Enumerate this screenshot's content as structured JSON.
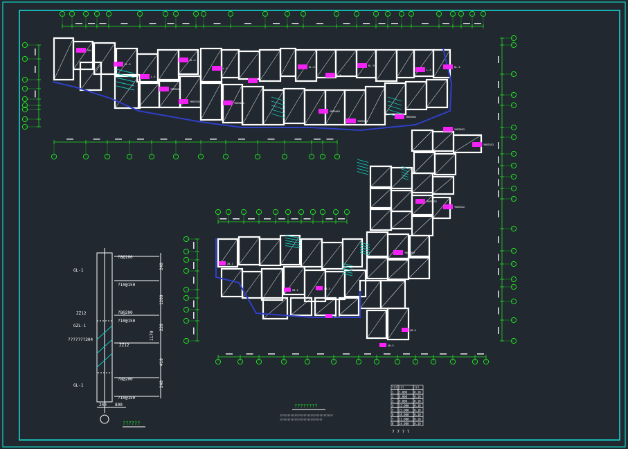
{
  "colors": {
    "background": "#212830",
    "frame": "#17d6d0",
    "wall": "#ffffff",
    "grid": "#22e022",
    "tag": "#ff22ff",
    "accent": "#2f3fc8",
    "hatch": "#13c9b9"
  },
  "detail": {
    "labels": [
      "GL-1",
      "ZZ12",
      "GZL-1",
      "GL-1"
    ],
    "note": "???????304",
    "callouts": [
      "?8@100",
      "?10@150",
      "?8@200",
      "?10@150",
      "?8@200",
      "?10@150"
    ],
    "right_dims": [
      "240",
      "1200",
      "220",
      "1170",
      "410",
      "240"
    ],
    "bottom_dims": [
      "240",
      "800"
    ],
    "marker": "ZZ12",
    "caption": "??????"
  },
  "notes": {
    "title": "????????",
    "line1": "????????????????????????????????????????",
    "line2": "????????????????????????????????"
  },
  "table": {
    "header": [
      "???",
      "???",
      "???"
    ],
    "rows": [
      [
        "1",
        "3.000",
        "0.10"
      ],
      [
        "2",
        "6.000",
        "0.10"
      ],
      [
        "3",
        "9.000",
        "0.10"
      ],
      [
        "4",
        "12.000",
        "0.10"
      ],
      [
        "5",
        "15.000",
        "0.10"
      ],
      [
        "6",
        "18.000",
        "0.10"
      ],
      [
        "7",
        "21.000",
        "0.10"
      ],
      [
        "8",
        "24.000",
        "0.10"
      ]
    ],
    "caption": "? ? ? ?"
  },
  "plan_tags": {
    "beams": [
      "YKL-1",
      "KL-3",
      "L-5",
      "KL-4",
      "L-1",
      "KL-2",
      "KL-6",
      "L-3",
      "KL-9",
      "L-2",
      "KL-5"
    ],
    "slabs": [
      "YKB3652",
      "YKB3352",
      "YKB3052",
      "YKB3662",
      "YKB3352",
      "YKB3652",
      "YKB3052",
      "YKB3352",
      "YKB3652",
      "YKB3352",
      "YKB3052",
      "YKB3652"
    ],
    "marks": [
      "XB-1",
      "XB-2",
      "XB-3",
      "XB-4",
      "XB-5",
      "XB-6"
    ]
  }
}
